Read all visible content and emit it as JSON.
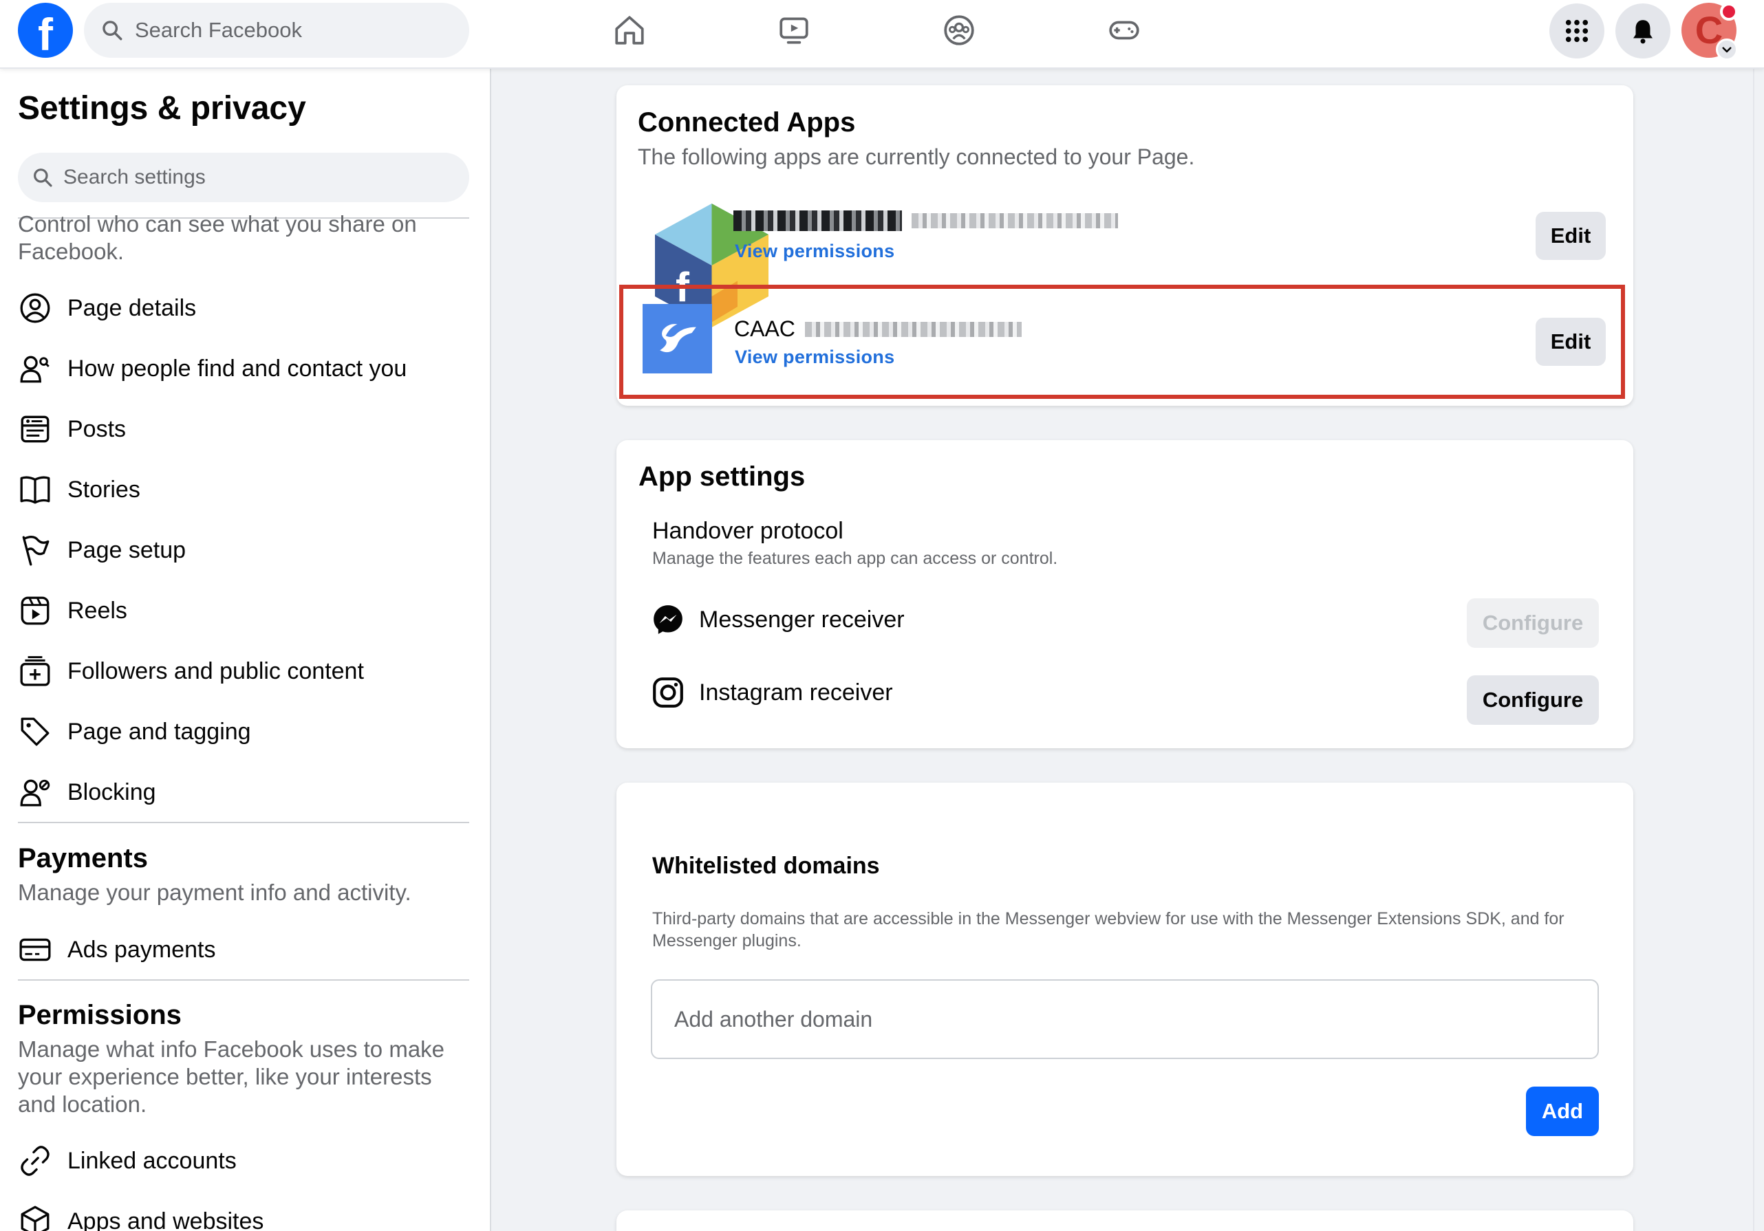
{
  "topbar": {
    "search_placeholder": "Search Facebook",
    "avatar_letter": "C"
  },
  "sidebar": {
    "title": "Settings & privacy",
    "search_placeholder": "Search settings",
    "intro_desc": "Control who can see what you share on Facebook.",
    "items": [
      {
        "label": "Page details",
        "icon": "user-circle-icon"
      },
      {
        "label": "How people find and contact you",
        "icon": "user-search-icon"
      },
      {
        "label": "Posts",
        "icon": "posts-icon"
      },
      {
        "label": "Stories",
        "icon": "book-icon"
      },
      {
        "label": "Page setup",
        "icon": "flag-icon"
      },
      {
        "label": "Reels",
        "icon": "reels-icon"
      },
      {
        "label": "Followers and public content",
        "icon": "followers-icon"
      },
      {
        "label": "Page and tagging",
        "icon": "tag-icon"
      },
      {
        "label": "Blocking",
        "icon": "user-block-icon"
      }
    ],
    "payments": {
      "title": "Payments",
      "desc": "Manage your payment info and activity.",
      "items": [
        {
          "label": "Ads payments",
          "icon": "credit-card-icon"
        }
      ]
    },
    "permissions": {
      "title": "Permissions",
      "desc": "Manage what info Facebook uses to make your experience better, like your interests and location.",
      "items": [
        {
          "label": "Linked accounts",
          "icon": "link-icon"
        },
        {
          "label": "Apps and websites",
          "icon": "cube-icon"
        }
      ]
    }
  },
  "connected_apps": {
    "title": "Connected Apps",
    "subtitle": "The following apps are currently connected to your Page.",
    "apps": [
      {
        "name": "",
        "view_permissions": "View permissions",
        "edit_label": "Edit"
      },
      {
        "name": "CAAC",
        "view_permissions": "View permissions",
        "edit_label": "Edit"
      }
    ]
  },
  "app_settings": {
    "title": "App settings",
    "handover_title": "Handover protocol",
    "handover_desc": "Manage the features each app can access or control.",
    "receivers": [
      {
        "label": "Messenger receiver",
        "button": "Configure",
        "enabled": false
      },
      {
        "label": "Instagram receiver",
        "button": "Configure",
        "enabled": true
      }
    ]
  },
  "whitelisted": {
    "title": "Whitelisted domains",
    "desc": "Third-party domains that are accessible in the Messenger webview for use with the Messenger Extensions SDK, and for Messenger plugins.",
    "input_placeholder": "Add another domain",
    "add_label": "Add"
  },
  "colors": {
    "brand_blue": "#0866ff",
    "link_blue": "#216fdb",
    "highlight_red": "#d0392c"
  }
}
